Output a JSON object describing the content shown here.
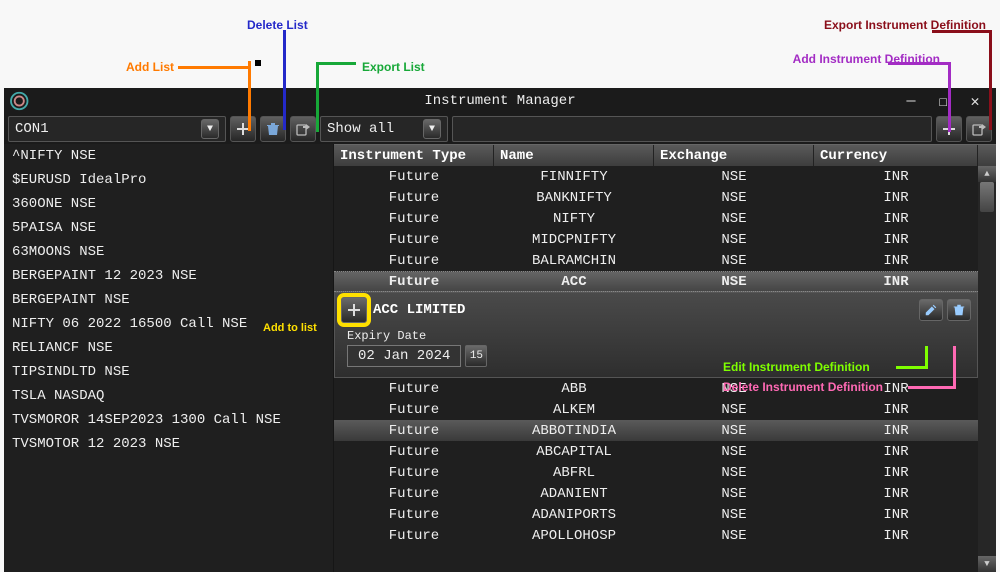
{
  "annotations": {
    "export_instrument_def": "Export Instrument Definition",
    "add_instrument_def": "Add Instrument Definition",
    "delete_list": "Delete List",
    "add_list": "Add List",
    "export_list": "Export List",
    "add_to_list": "Add to list",
    "edit_instrument_def": "Edit Instrument Definition",
    "delete_instrument_def": "Delete Instrument Definition"
  },
  "colors": {
    "export_instr": "#8a0e1a",
    "add_instr": "#a32cc4",
    "delete_list": "#2429c9",
    "add_list": "#ff7a00",
    "export_list": "#17a838",
    "add_to_list": "#ffe000",
    "edit_instr": "#7fff00",
    "delete_instr": "#ff69b4"
  },
  "window": {
    "title": "Instrument Manager"
  },
  "toolbar": {
    "list_selected": "CON1",
    "filter_selected": "Show all",
    "search_value": ""
  },
  "left_items": [
    "^NIFTY NSE",
    "$EURUSD IdealPro",
    "360ONE NSE",
    "5PAISA NSE",
    "63MOONS NSE",
    "BERGEPAINT 12 2023 NSE",
    "BERGEPAINT NSE",
    "NIFTY 06 2022 16500 Call NSE",
    "RELIANCF NSE",
    "TIPSINDLTD NSE",
    "TSLA NASDAQ",
    "TVSMOROR 14SEP2023 1300 Call NSE",
    "TVSMOTOR 12 2023 NSE"
  ],
  "columns": [
    "Instrument Type",
    "Name",
    "Exchange",
    "Currency"
  ],
  "rows_top": [
    {
      "type": "Future",
      "name": "FINNIFTY",
      "exch": "NSE",
      "cur": "INR"
    },
    {
      "type": "Future",
      "name": "BANKNIFTY",
      "exch": "NSE",
      "cur": "INR"
    },
    {
      "type": "Future",
      "name": "NIFTY",
      "exch": "NSE",
      "cur": "INR"
    },
    {
      "type": "Future",
      "name": "MIDCPNIFTY",
      "exch": "NSE",
      "cur": "INR"
    },
    {
      "type": "Future",
      "name": "BALRAMCHIN",
      "exch": "NSE",
      "cur": "INR"
    }
  ],
  "row_selected": {
    "type": "Future",
    "name": "ACC",
    "exch": "NSE",
    "cur": "INR"
  },
  "detail": {
    "title": "ACC LIMITED",
    "expiry_label": "Expiry Date",
    "expiry_value": "02 Jan 2024"
  },
  "rows_bottom": [
    {
      "type": "Future",
      "name": "ABB",
      "exch": "NSE",
      "cur": "INR"
    },
    {
      "type": "Future",
      "name": "ALKEM",
      "exch": "NSE",
      "cur": "INR"
    },
    {
      "type": "Future",
      "name": "ABBOTINDIA",
      "exch": "NSE",
      "cur": "INR",
      "hl": true
    },
    {
      "type": "Future",
      "name": "ABCAPITAL",
      "exch": "NSE",
      "cur": "INR"
    },
    {
      "type": "Future",
      "name": "ABFRL",
      "exch": "NSE",
      "cur": "INR"
    },
    {
      "type": "Future",
      "name": "ADANIENT",
      "exch": "NSE",
      "cur": "INR"
    },
    {
      "type": "Future",
      "name": "ADANIPORTS",
      "exch": "NSE",
      "cur": "INR"
    },
    {
      "type": "Future",
      "name": "APOLLOHOSP",
      "exch": "NSE",
      "cur": "INR"
    }
  ],
  "cal_label": "15"
}
